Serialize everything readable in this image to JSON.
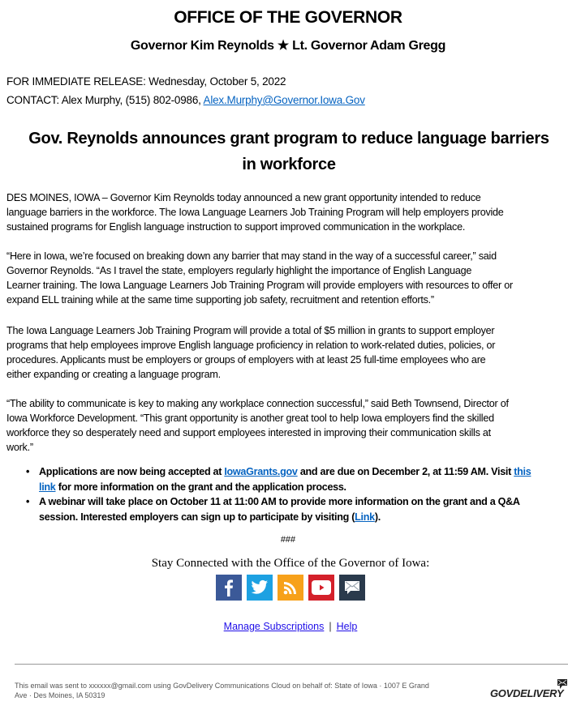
{
  "header": {
    "title": "OFFICE OF THE GOVERNOR",
    "subtitle": "Governor Kim Reynolds ★ Lt. Governor Adam Gregg"
  },
  "release": {
    "line": "FOR IMMEDIATE RELEASE: Wednesday, October 5, 2022",
    "contact_prefix": "CONTACT: Alex Murphy, (515) 802-0986, ",
    "contact_email": "Alex.Murphy@Governor.Iowa.Gov"
  },
  "headline": {
    "line1": "Gov. Reynolds announces grant program to reduce language barriers",
    "line2": "in workforce"
  },
  "paragraphs": [
    {
      "lines": [
        "DES MOINES, IOWA – Governor Kim Reynolds today announced a new grant opportunity intended to reduce",
        "language barriers in the workforce. The Iowa Language Learners Job Training Program will help employers provide",
        "sustained programs for English language instruction to support improved communication in the workplace."
      ]
    },
    {
      "lines": [
        "“Here in Iowa, we’re focused on breaking down any barrier that may stand in the way of a successful career,” said",
        "Governor Reynolds. “As I travel the state, employers regularly highlight the importance of English Language",
        "Learner training. The Iowa Language Learners Job Training Program will provide employers with resources to offer or",
        "expand ELL training while at the same time supporting job safety, recruitment and retention efforts.”"
      ]
    },
    {
      "lines": [
        "The Iowa Language Learners Job Training Program will provide a total of $5 million in grants to support employer",
        "programs that help employees improve English language proficiency in relation to work-related duties, policies, or",
        "procedures. Applicants must be employers or groups of employers with at least 25 full-time employees who are",
        "either expanding or creating a language program."
      ]
    },
    {
      "lines": [
        "“The ability to communicate is key to making any workplace connection successful,” said Beth Townsend, Director of",
        "Iowa Workforce Development. “This grant opportunity is another great tool to help Iowa employers find the skilled",
        "workforce they so desperately need and support employees interested in improving their communication skills at",
        "work.”"
      ]
    }
  ],
  "bullets": [
    {
      "part1": "Applications are now being accepted at ",
      "link1": "IowaGrants.gov",
      "part2": " and are due on December 2, at 11:59 AM. Visit ",
      "link2a": "this",
      "link2b": "link",
      "part3": " for more information on the grant and the application process."
    },
    {
      "line1": "A webinar will take place on October 11 at 11:00 AM to provide more information on the grant and a Q&A",
      "part1": "session. Interested employers can sign up to participate by visiting (",
      "link": "Link",
      "part2": ")."
    }
  ],
  "closing": {
    "hashes": "###",
    "stay_connected": "Stay Connected with the Office of the Governor of Iowa:"
  },
  "social": [
    {
      "name": "facebook",
      "icon": "facebook-icon",
      "color": "#3b5998"
    },
    {
      "name": "twitter",
      "icon": "twitter-icon",
      "color": "#1da1e2"
    },
    {
      "name": "rss",
      "icon": "rss-icon",
      "color": "#f7a11a"
    },
    {
      "name": "youtube",
      "icon": "youtube-icon",
      "color": "#d4202a"
    },
    {
      "name": "email",
      "icon": "email-icon",
      "color": "#2a3a4c"
    }
  ],
  "links": {
    "manage": "Manage Subscriptions",
    "separator": "|",
    "help": "Help"
  },
  "footer": {
    "line1": "This email was sent to xxxxxx@gmail.com using GovDelivery Communications Cloud on behalf of: State of Iowa · 1007 E Grand",
    "line2": "Ave · Des Moines, IA 50319",
    "logo_text": "GOVDELIVERY"
  }
}
